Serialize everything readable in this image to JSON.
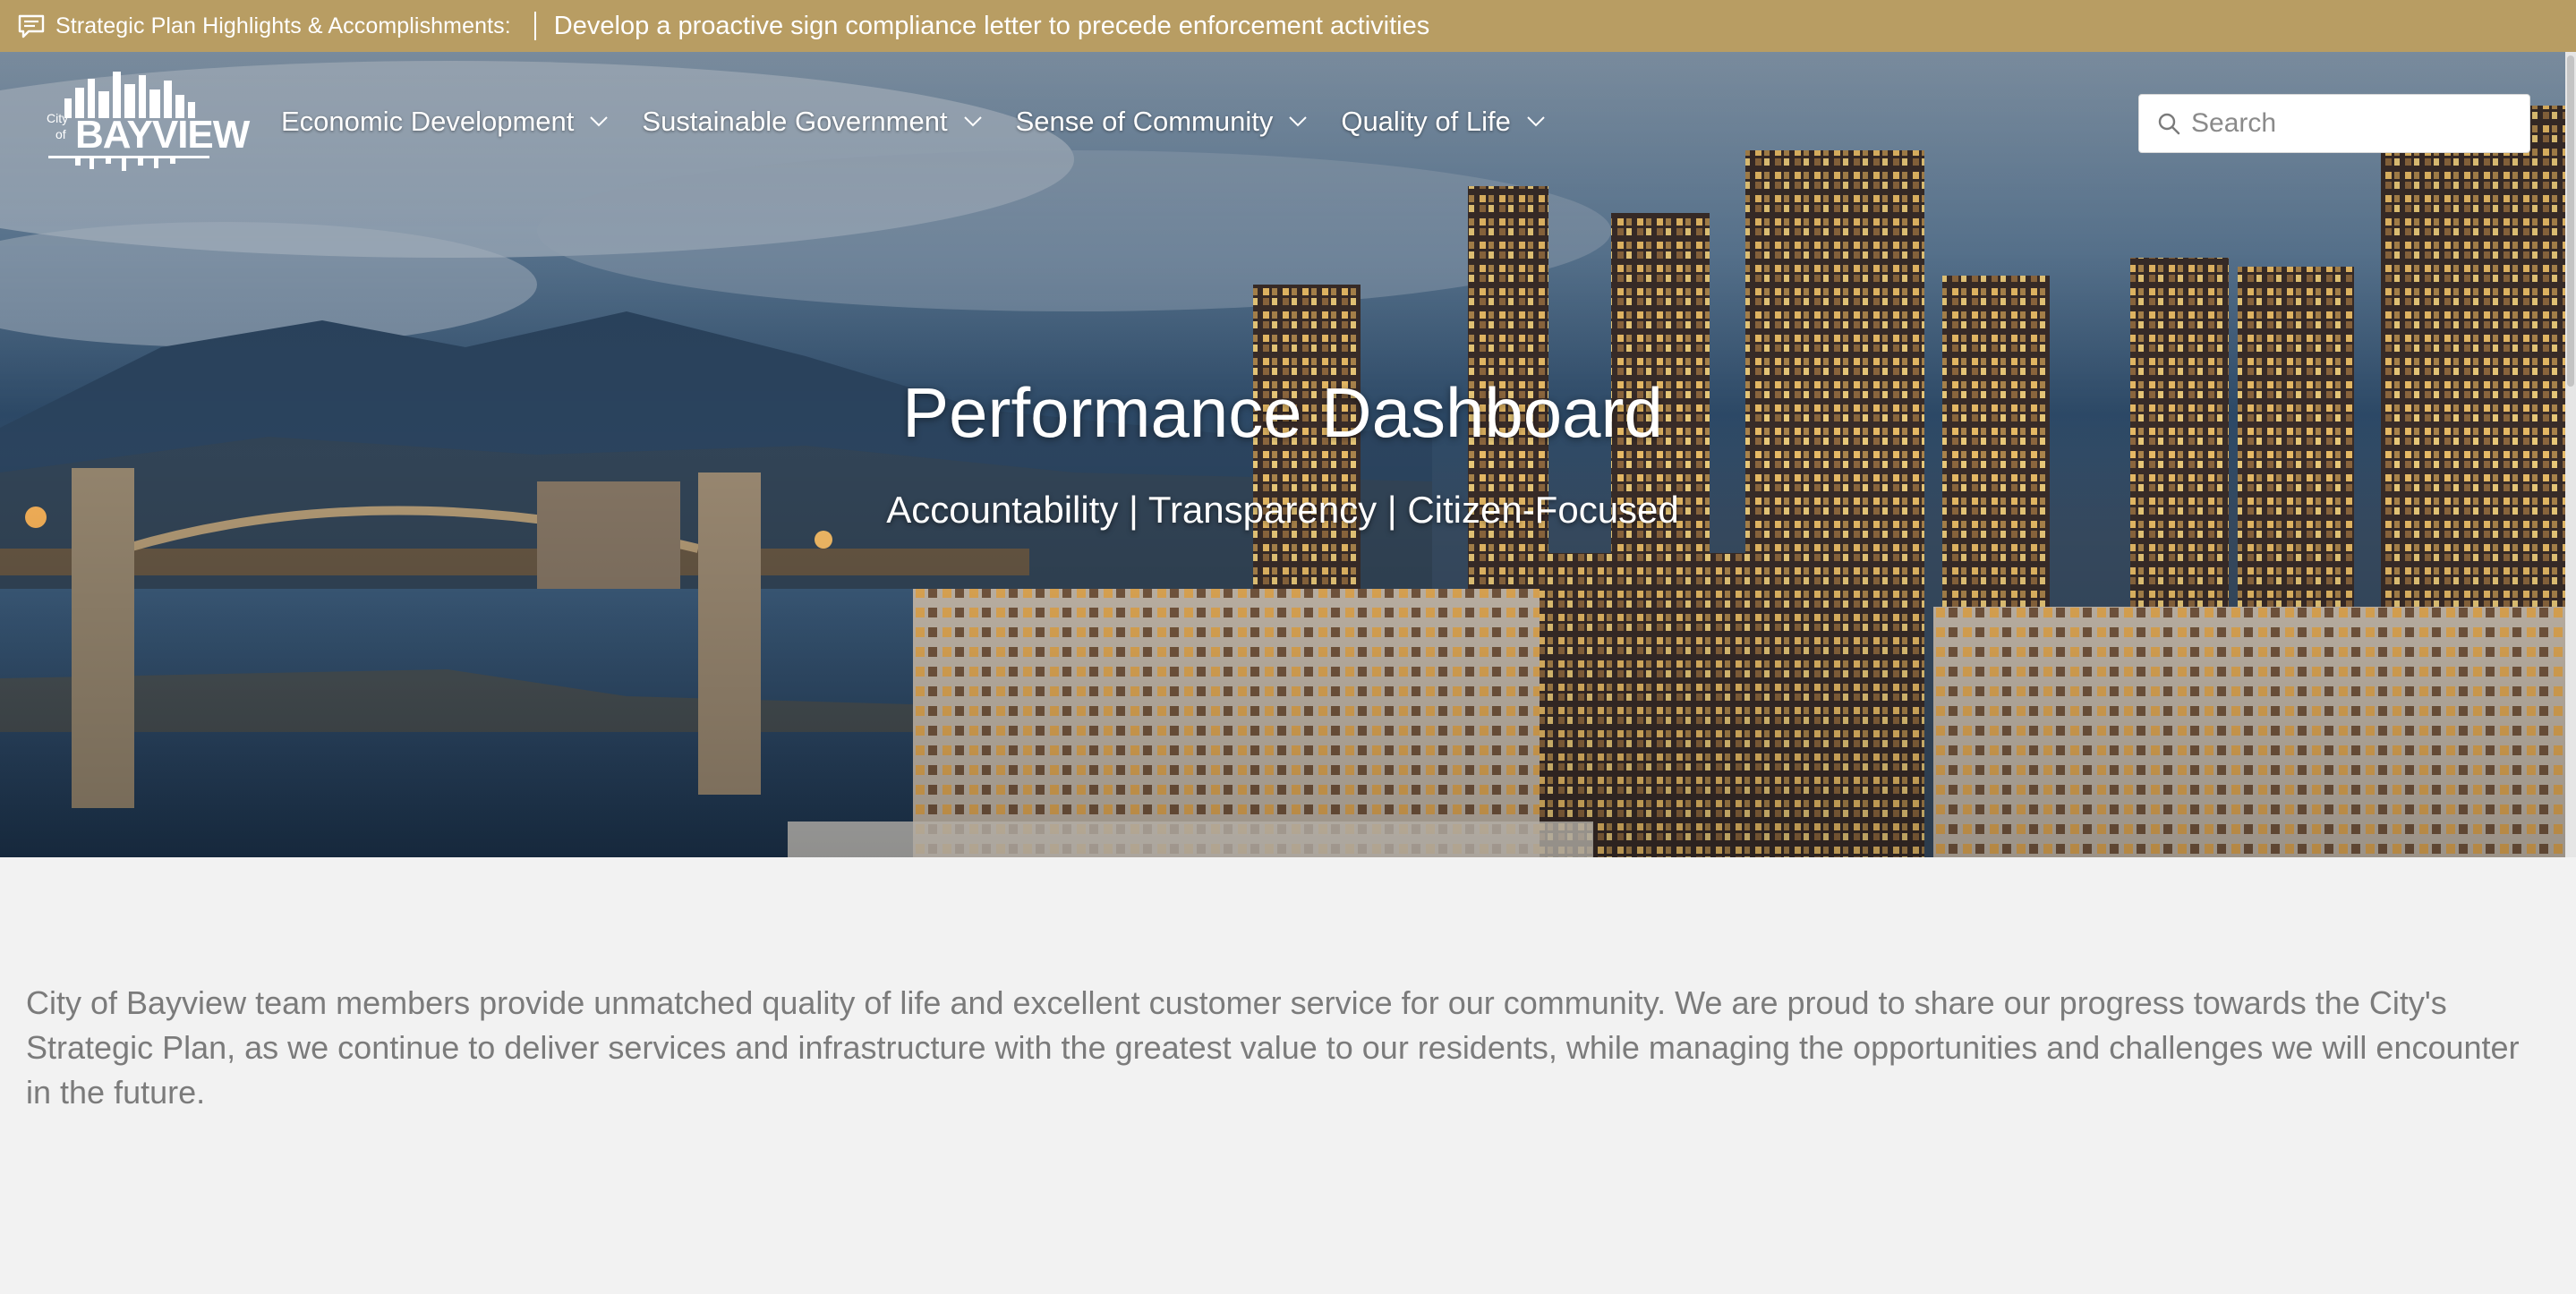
{
  "announcement": {
    "icon": "message-icon",
    "label": "Strategic Plan Highlights & Accomplishments:",
    "text": "Develop a proactive sign compliance letter to precede enforcement activities",
    "background": "#b89d63"
  },
  "logo": {
    "prefix_line1": "City",
    "prefix_line2": "of",
    "name": "BAYVIEW"
  },
  "nav": {
    "items": [
      {
        "label": "Economic Development"
      },
      {
        "label": "Sustainable Government"
      },
      {
        "label": "Sense of Community"
      },
      {
        "label": "Quality of Life"
      }
    ],
    "search_placeholder": "Search"
  },
  "hero": {
    "title": "Performance Dashboard",
    "subtitle": "Accountability | Transparency | Citizen-Focused"
  },
  "intro": {
    "text": "City of Bayview team members provide unmatched quality of life and excellent customer service for our community. We are proud to share our progress towards the City's Strategic Plan, as we continue to deliver services and infrastructure with the greatest value to our residents, while managing the opportunities and challenges we will encounter in the future."
  }
}
